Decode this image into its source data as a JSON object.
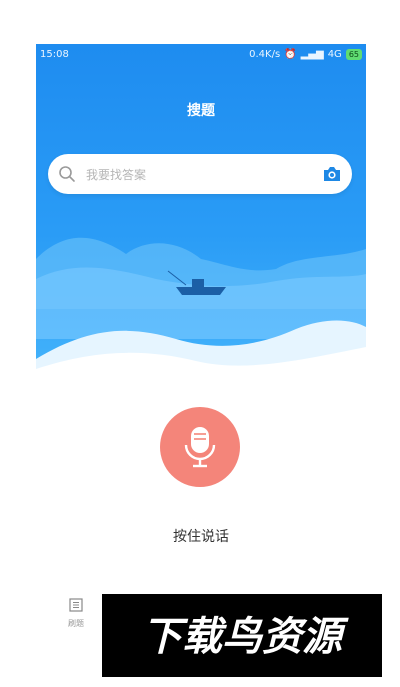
{
  "status_bar": {
    "time": "15:08",
    "speed": "0.4K/s",
    "network": "4G",
    "battery": "65"
  },
  "header": {
    "title": "搜题"
  },
  "search": {
    "placeholder": "我要找答案"
  },
  "voice": {
    "label": "按住说话"
  },
  "tabs": [
    {
      "label": "刷题",
      "icon": "list-icon"
    }
  ],
  "watermark": {
    "text": "下载鸟资源"
  },
  "colors": {
    "hero_blue": "#2a9cf6",
    "mic_red": "#f4857a",
    "camera_blue": "#1e88e5"
  }
}
